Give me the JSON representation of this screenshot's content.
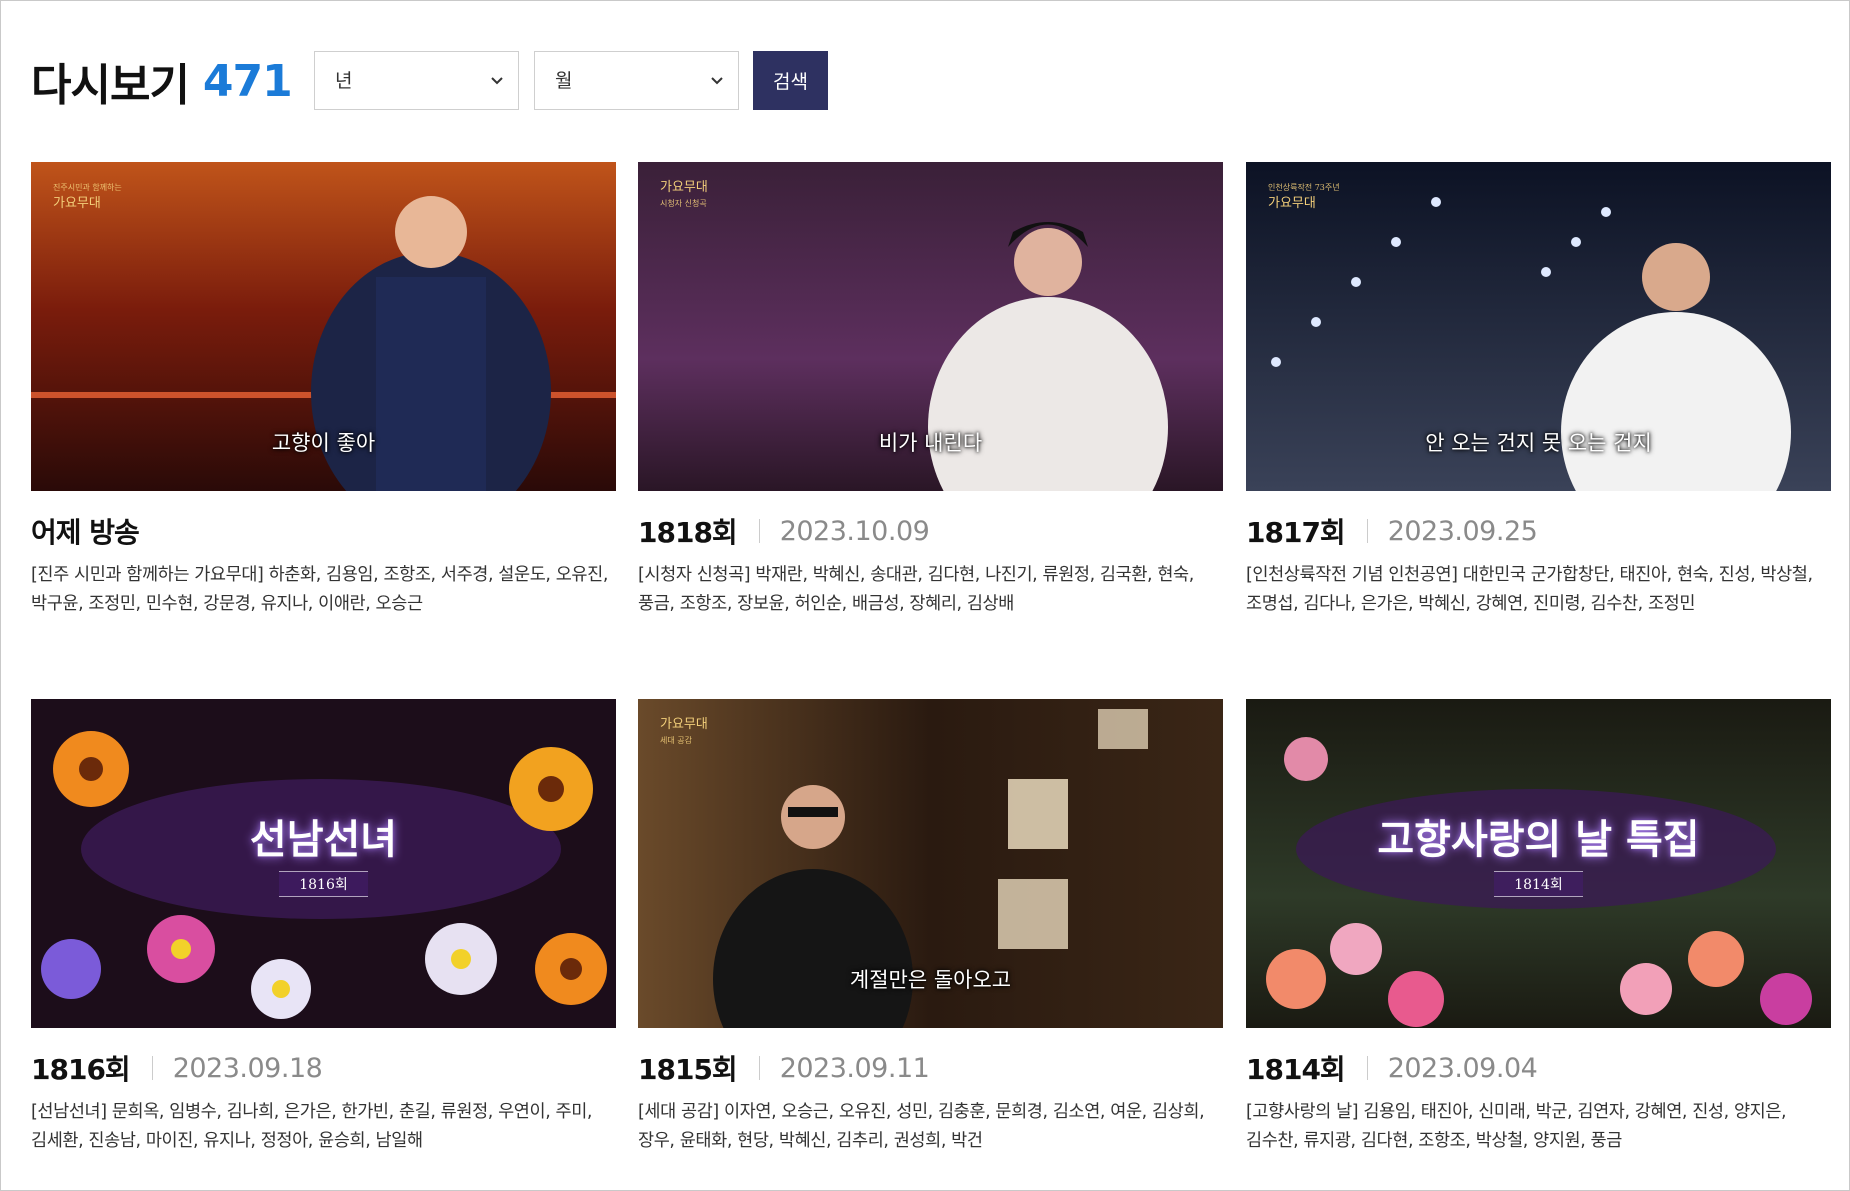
{
  "header": {
    "title": "다시보기",
    "count": "471"
  },
  "filters": {
    "year_value": "년",
    "month_value": "월",
    "search_label": "검색"
  },
  "episodes": [
    {
      "label": "어제 방송",
      "date": "",
      "description": "[진주 시민과 함께하는 가요무대] 하춘화, 김용임, 조항조, 서주경, 설운도, 오유진, 박구윤, 조정민, 민수현, 강문경, 유지나, 이애란, 오승근",
      "thumb_subtitle": "고향이 좋아",
      "thumb_logo": "가요무대",
      "thumb_logo_small": "진주시민과 함께하는"
    },
    {
      "label": "1818회",
      "date": "2023.10.09",
      "description": "[시청자 신청곡] 박재란, 박혜신, 송대관, 김다현, 나진기, 류원정, 김국환, 현숙, 풍금, 조항조, 장보윤, 허인순, 배금성, 장혜리, 김상배",
      "thumb_subtitle": "비가 내린다",
      "thumb_logo": "가요무대",
      "thumb_logo_small": "시청자 신청곡"
    },
    {
      "label": "1817회",
      "date": "2023.09.25",
      "description": "[인천상륙작전 기념 인천공연] 대한민국 군가합창단, 태진아, 현숙, 진성, 박상철, 조명섭, 김다나, 은가은, 박혜신, 강혜연, 진미령, 김수찬, 조정민",
      "thumb_subtitle": "안 오는 건지 못 오는 건지",
      "thumb_logo": "가요무대",
      "thumb_logo_small": "인천상륙작전 73주년"
    },
    {
      "label": "1816회",
      "date": "2023.09.18",
      "description": "[선남선녀] 문희옥, 임병수, 김나희, 은가은, 한가빈, 춘길, 류원정, 우연이, 주미, 김세환, 진송남, 마이진, 유지나, 정정아, 윤승희, 남일해",
      "thumb_title": "선남선녀",
      "thumb_ep": "1816회"
    },
    {
      "label": "1815회",
      "date": "2023.09.11",
      "description": "[세대 공감] 이자연, 오승근, 오유진, 성민, 김충훈, 문희경, 김소연, 여운, 김상희, 장우, 윤태화, 현당, 박혜신, 김추리, 권성희, 박건",
      "thumb_subtitle": "계절만은 돌아오고",
      "thumb_logo": "가요무대",
      "thumb_logo_small": "세대 공감"
    },
    {
      "label": "1814회",
      "date": "2023.09.04",
      "description": "[고향사랑의 날] 김용임, 태진아, 신미래, 박군, 김연자, 강혜연, 진성, 양지은, 김수찬, 류지광, 김다현, 조항조, 박상철, 양지원, 풍금",
      "thumb_title": "고향사랑의 날 특집",
      "thumb_ep": "1814회"
    }
  ],
  "icons": {
    "select_chevron": "chevron-down-icon"
  },
  "colors": {
    "accent_count": "#1b7bd8",
    "search_button": "#2e3161",
    "date_text": "#8a8a8a"
  }
}
